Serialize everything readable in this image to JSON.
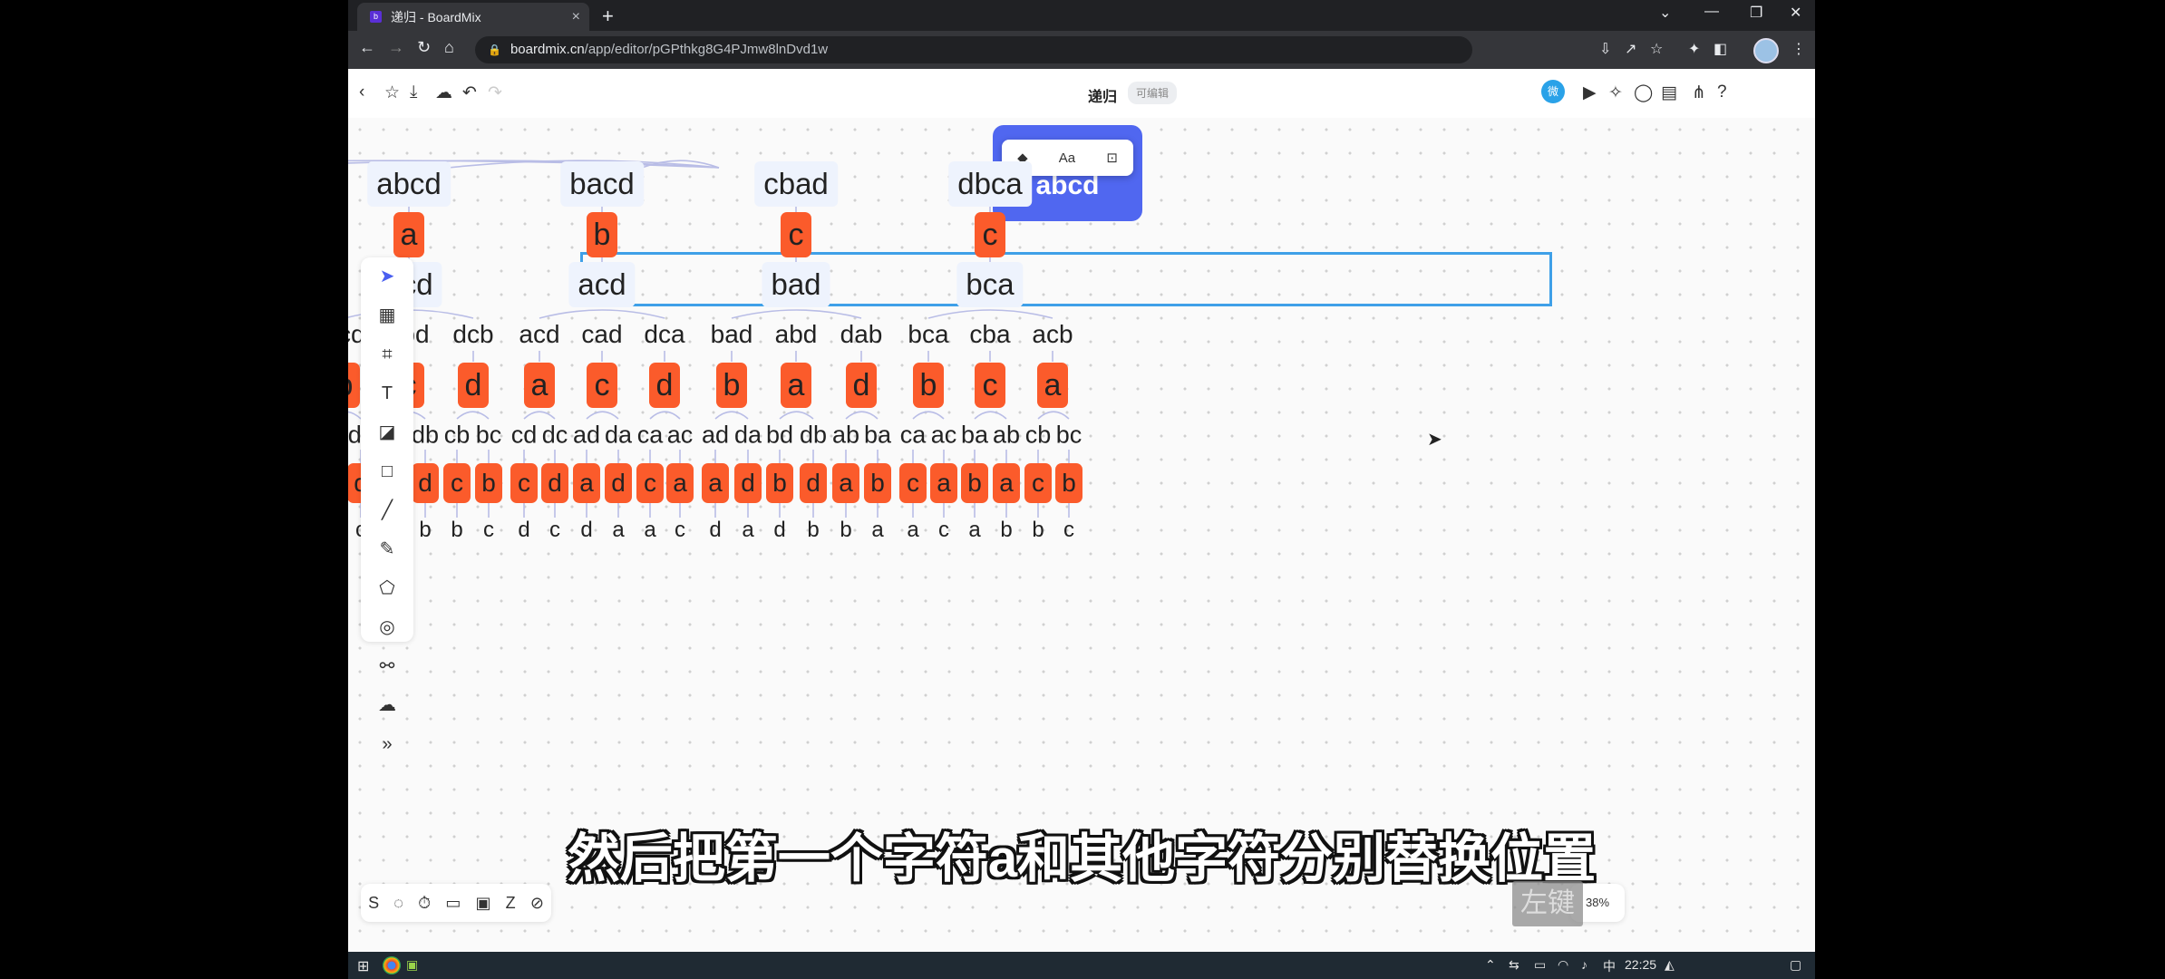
{
  "browser": {
    "tab_title": "递归 - BoardMix",
    "tab_close": "×",
    "new_tab": "+",
    "window_controls": [
      "⌄",
      "—",
      "❐",
      "✕"
    ],
    "url_host": "boardmix.cn",
    "url_path": "/app/editor/pGPthkg8G4PJmw8lnDvd1w",
    "nav_icons": [
      "back-icon",
      "forward-icon",
      "reload-icon",
      "home-icon"
    ]
  },
  "toolbar": {
    "title": "递归",
    "edit_badge": "可编辑",
    "left_icons": [
      "back-icon",
      "star-icon",
      "download-icon",
      "cloud-icon",
      "undo-icon",
      "redo-icon"
    ],
    "right_icons": [
      "wechat-icon",
      "play-icon",
      "celebrate-icon",
      "comment-icon",
      "layout-icon",
      "share-icon",
      "help-icon"
    ],
    "wechat_glyph": "微"
  },
  "canvas": {
    "root_label": "abcd",
    "popover": [
      "◆",
      "Aa",
      "⊡"
    ],
    "level1": [
      "abcd",
      "bacd",
      "cbad",
      "dbca"
    ],
    "level1_badges": [
      "a",
      "b",
      "c",
      "c"
    ],
    "level2": [
      "bcd",
      "acd",
      "bad",
      "bca"
    ],
    "level3": [
      "bcd",
      "cbd",
      "dcb",
      "acd",
      "cad",
      "dca",
      "bad",
      "abd",
      "dab",
      "bca",
      "cba",
      "acb"
    ],
    "level3_badges": [
      "b",
      "c",
      "d",
      "a",
      "c",
      "d",
      "b",
      "a",
      "d",
      "b",
      "c",
      "a"
    ],
    "level4": [
      "cd",
      "dc",
      "bd",
      "db",
      "cb",
      "bc",
      "cd",
      "dc",
      "ad",
      "da",
      "ca",
      "ac",
      "ad",
      "da",
      "bd",
      "db",
      "ab",
      "ba",
      "ca",
      "ac",
      "ba",
      "ab",
      "cb",
      "bc"
    ],
    "level4_badges": [
      "c",
      "d",
      "b",
      "d",
      "c",
      "b",
      "c",
      "d",
      "a",
      "d",
      "c",
      "a",
      "a",
      "d",
      "b",
      "d",
      "a",
      "b",
      "c",
      "a",
      "b",
      "a",
      "c",
      "b"
    ],
    "level5": [
      "d",
      "c",
      "d",
      "b",
      "b",
      "c",
      "d",
      "c",
      "d",
      "a",
      "a",
      "c",
      "d",
      "a",
      "d",
      "b",
      "b",
      "a",
      "a",
      "c",
      "a",
      "b",
      "b",
      "c"
    ]
  },
  "left_tools": [
    "select-icon",
    "template-icon",
    "frame-icon",
    "text-icon",
    "sticky-note-icon",
    "shape-icon",
    "line-icon",
    "pen-icon",
    "polygon-icon",
    "ai-icon",
    "mindmap-icon",
    "upload-icon",
    "more-icon"
  ],
  "left_tool_glyphs": [
    "➤",
    "▦",
    "⌗",
    "T",
    "◪",
    "□",
    "╱",
    "✎",
    "⬠",
    "◎",
    "⚯",
    "☁",
    "»"
  ],
  "bottom_tools": [
    "S",
    "◌",
    "⏱",
    "▭",
    "▣",
    "Z",
    "⊘"
  ],
  "zoom": "38%",
  "subtitle": "然后把第一个字符a和其他字符分别替换位置",
  "key_hint": "左键",
  "taskbar": {
    "time": "22:25",
    "ime": "中"
  }
}
